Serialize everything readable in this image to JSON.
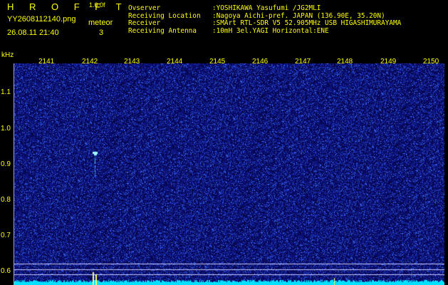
{
  "header": {
    "title": "H R O F F T",
    "version": "1.0.0f",
    "filename": "YY2608112140.png",
    "meteor_label": "meteor",
    "datetime": "26.08.11 21:40",
    "meteor_count": "3"
  },
  "info": [
    {
      "key": "Ovserver",
      "value": ":YOSHIKAWA Yasufumi /JG2MLI"
    },
    {
      "key": "Receiving Location",
      "value": ":Nagoya Aichi-pref. JAPAN (136.90E, 35.20N)"
    },
    {
      "key": "Receiver",
      "value": ":SMArt RTL-SDR V5 52.905MHz USB HIGASHIMURAYAMA"
    },
    {
      "key": "Receiving Antenna",
      "value": ":10mH 3el.YAGI Horizontal:ENE"
    }
  ],
  "axis": {
    "unit": "kHz",
    "time_ticks": [
      "2141",
      "2142",
      "2143",
      "2144",
      "2145",
      "2146",
      "2147",
      "2148",
      "2149",
      "2150"
    ],
    "freq_ticks": [
      "1.1",
      "1.0",
      "0.9",
      "0.8",
      "0.7",
      "0.6"
    ]
  },
  "colors": {
    "text": "#ffff00",
    "background": "#000000",
    "noise_base": "#0a0a6a",
    "noise_bright": "#3a6aff",
    "carrier": "#00e8ff",
    "meteor": "#9ffcff"
  }
}
